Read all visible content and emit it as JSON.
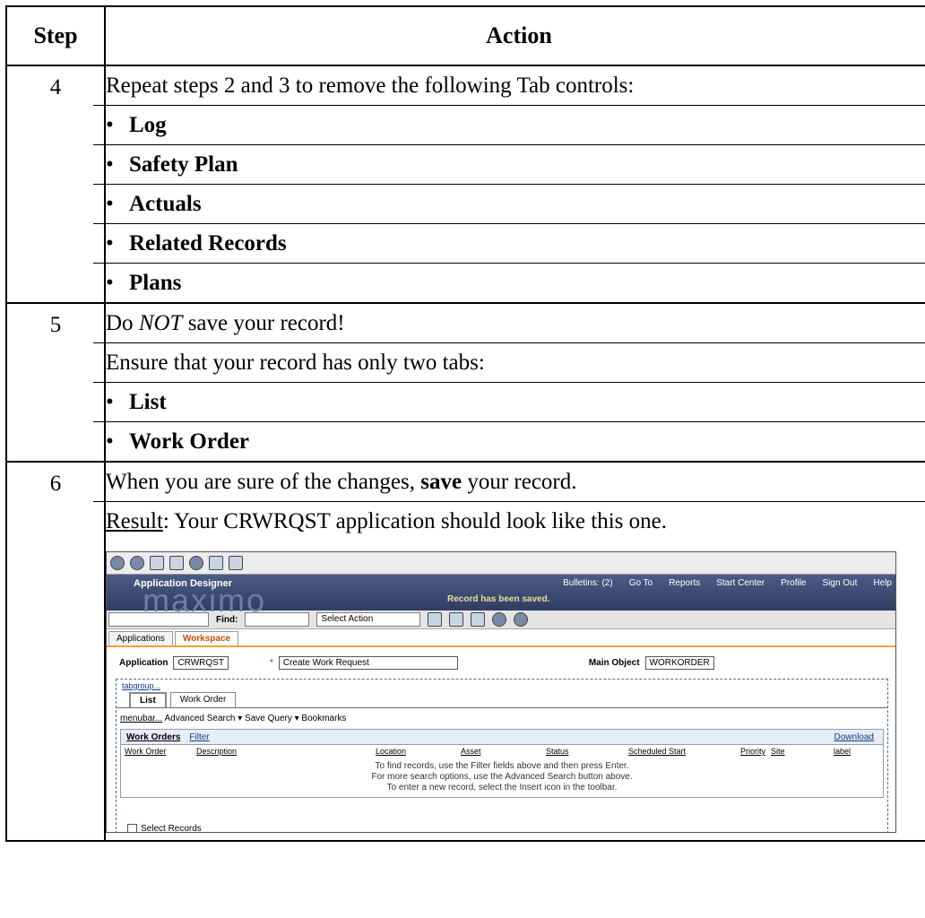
{
  "header": {
    "step": "Step",
    "action": "Action"
  },
  "rows": [
    {
      "step": "4",
      "intro": "Repeat steps 2 and 3 to remove the following Tab controls:",
      "bullets": [
        "Log",
        "Safety Plan",
        "Actuals",
        "Related Records",
        "Plans"
      ]
    },
    {
      "step": "5",
      "line1_pre": "Do ",
      "line1_em": "NOT",
      "line1_post": " save your record!",
      "line2": "Ensure that your record has only two tabs:",
      "bullets": [
        "List",
        "Work Order"
      ]
    },
    {
      "step": "6",
      "line1_pre": "When you are sure of the changes, ",
      "line1_bold": "save",
      "line1_post": " your record.",
      "result_label": "Result",
      "result_text": ": Your CRWRQST application should look like this one."
    }
  ],
  "screenshot": {
    "app_title": "Application Designer",
    "logo": "maximo",
    "bulletins": "Bulletins: (2)",
    "goto": "Go To",
    "reports": "Reports",
    "start_center": "Start Center",
    "profile": "Profile",
    "sign_out": "Sign Out",
    "help": "Help",
    "saved_msg": "Record has been saved.",
    "find_label": "Find:",
    "select_action": "Select Action",
    "tab_applications": "Applications",
    "tab_workspace": "Workspace",
    "application_label": "Application",
    "application_value": "CRWRQST",
    "description_value": "Create Work Request",
    "main_object_label": "Main Object",
    "main_object_value": "WORKORDER",
    "tabgroup": "tabgroup...",
    "subtab_list": "List",
    "subtab_workorder": "Work Order",
    "menubar": "menubar...",
    "advanced_search": "Advanced Search",
    "save_query": "Save Query",
    "bookmarks": "Bookmarks",
    "grid_title": "Work Orders",
    "filter": "Filter",
    "download": "Download",
    "columns": [
      "Work Order",
      "Description",
      "Location",
      "Asset",
      "Status",
      "Scheduled Start",
      "Priority",
      "Site",
      "label"
    ],
    "hint1": "To find records, use the Filter fields above and then press Enter.",
    "hint2": "For more search options, use the Advanced Search button above.",
    "hint3": "To enter a new record, select the Insert icon in the toolbar.",
    "select_records": "Select Records"
  }
}
